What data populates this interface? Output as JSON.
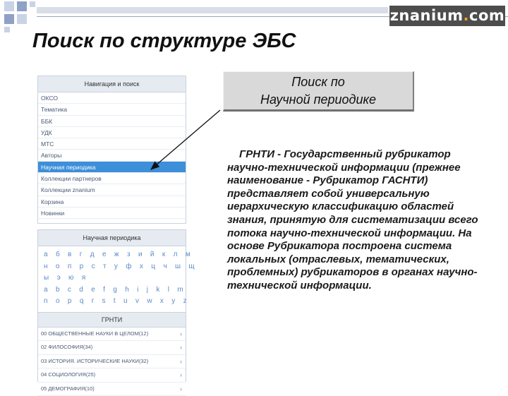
{
  "logo": {
    "text": "znanium",
    "dot": ".",
    "suffix": "com"
  },
  "page_title": "Поиск по структуре ЭБС",
  "nav_panel": {
    "header": "Навигация и поиск",
    "items": [
      {
        "label": "ОКСО",
        "active": false
      },
      {
        "label": "Тематика",
        "active": false
      },
      {
        "label": "ББК",
        "active": false
      },
      {
        "label": "УДК",
        "active": false
      },
      {
        "label": "МТС",
        "active": false
      },
      {
        "label": "Авторы",
        "active": false
      },
      {
        "label": "Научная периодика",
        "active": true
      },
      {
        "label": "Коллекции партнеров",
        "active": false
      },
      {
        "label": "Коллекции znanium",
        "active": false
      },
      {
        "label": "Корзина",
        "active": false
      },
      {
        "label": "Новинки",
        "active": false
      }
    ]
  },
  "periodic_panel": {
    "header": "Научная периодика",
    "alphabet_rows": [
      "а б в г д е ж з и й к л м",
      "н о п р с т у ф х ц ч ш щ",
      "ы э ю я",
      "a b c d e f g h i j k l m",
      "n o p q r s t u v w x y z"
    ],
    "grnti_header": "ГРНТИ",
    "grnti_items": [
      "00 ОБЩЕСТВЕННЫЕ НАУКИ В ЦЕЛОМ(12)",
      "02 ФИЛОСОФИЯ(34)",
      "03 ИСТОРИЯ. ИСТОРИЧЕСКИЕ НАУКИ(32)",
      "04 СОЦИОЛОГИЯ(25)",
      "05 ДЕМОГРАФИЯ(10)"
    ]
  },
  "callout": {
    "line1": "Поиск по",
    "line2": "Научной периодике"
  },
  "description": "ГРНТИ - Государственный рубрикатор научно-технической информации (прежнее наименование - Рубрикатор ГАСНТИ) представляет собой универсальную иерархическую классификацию областей знания, принятую для систематизации всего потока научно-технической информации. На основе Рубрикатора построена система локальных (отраслевых, тематических, проблемных) рубрикаторов в органах научно-технической информации.",
  "colors": {
    "active_item": "#3d8fd9",
    "panel_header": "#e6ebf2",
    "callout_bg": "#d9d9d9",
    "logo_bg": "#4d4d4d",
    "logo_dot": "#f0a020",
    "alphabet_link": "#5a8ac8"
  }
}
